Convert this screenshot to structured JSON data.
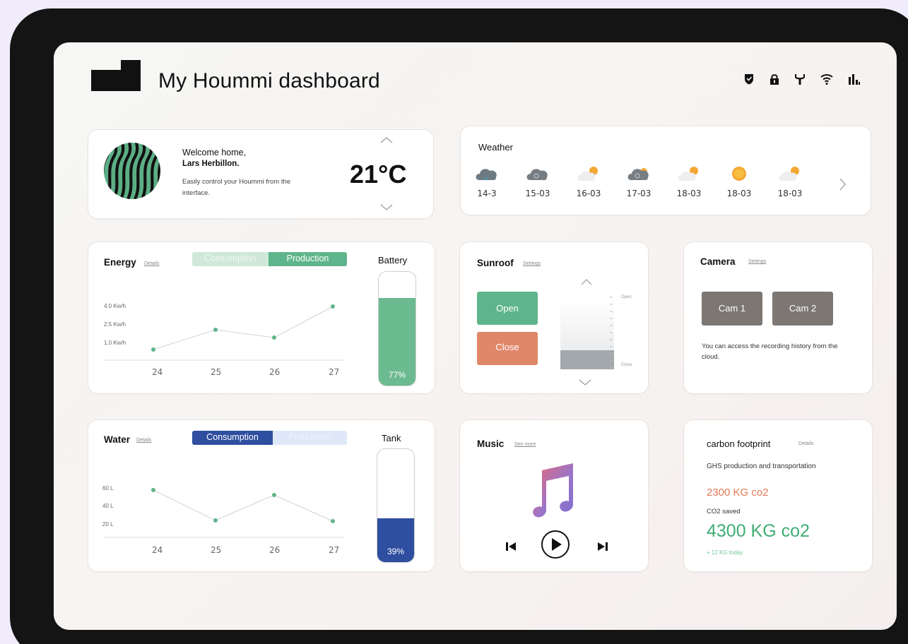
{
  "app": {
    "title": "My Hoummi dashboard"
  },
  "status_icons": [
    "shield-icon",
    "lock-icon",
    "antenna-icon",
    "wifi-icon",
    "signal-bars-icon"
  ],
  "welcome": {
    "greeting": "Welcome home,",
    "name": "Lars Herbillon.",
    "description": "Easily control your Hoummi from the interface.",
    "temperature": "21°C"
  },
  "weather": {
    "title": "Weather",
    "days": [
      {
        "date": "14-3",
        "icon": "cloud-rain-icon"
      },
      {
        "date": "15-03",
        "icon": "cloud-snow-icon"
      },
      {
        "date": "16-03",
        "icon": "partly-cloudy-icon"
      },
      {
        "date": "17-03",
        "icon": "cloud-sun-snow-icon"
      },
      {
        "date": "18-03",
        "icon": "partly-cloudy-icon"
      },
      {
        "date": "18-03",
        "icon": "sun-icon"
      },
      {
        "date": "18-03",
        "icon": "partly-cloudy-icon"
      }
    ]
  },
  "energy": {
    "title": "Energy",
    "details_link": "Details",
    "tabs": [
      "Consumption",
      "Production"
    ],
    "active_tab": "Production",
    "y_labels": [
      "4.0 Kw/h",
      "2.5 Kw/h",
      "1.0 Kw/h"
    ],
    "x_labels": [
      "24",
      "25",
      "26",
      "27"
    ],
    "battery_label": "Battery",
    "battery_value": "77%",
    "battery_level": 0.77
  },
  "water": {
    "title": "Water",
    "details_link": "Details",
    "tabs": [
      "Consumption",
      "Production"
    ],
    "active_tab": "Consumption",
    "y_labels": [
      "60 L",
      "40 L",
      "20 L"
    ],
    "x_labels": [
      "24",
      "25",
      "26",
      "27"
    ],
    "tank_label": "Tank",
    "tank_value": "39%",
    "tank_level": 0.39
  },
  "sunroof": {
    "title": "Sunroof",
    "settings_link": "Settings",
    "open_label": "Open",
    "close_label": "Close",
    "scale_top": "Open",
    "scale_bottom": "Close",
    "level": 0.27
  },
  "camera": {
    "title": "Camera",
    "settings_link": "Settings",
    "cams": [
      "Cam 1",
      "Cam 2"
    ],
    "note": "You can access the recording history from the cloud."
  },
  "music": {
    "title": "Music",
    "see_more_link": "See more"
  },
  "carbon": {
    "title": "carbon footprint",
    "details_link": "Details",
    "subtitle": "GHS production and transportation",
    "produced": "2300 KG co2",
    "saved_label": "CO2 saved",
    "saved": "4300 KG co2",
    "today": "+ 12 KG today"
  },
  "colors": {
    "green": "#5fb58b",
    "green_light": "#cfe8d9",
    "blue": "#2f4ea0",
    "blue_light": "#dfe8f8",
    "orange": "#e0876a",
    "gray_button": "#7d7774"
  }
}
